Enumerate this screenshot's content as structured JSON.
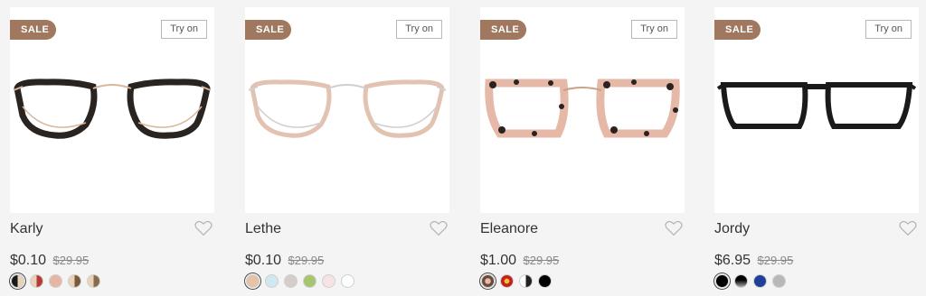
{
  "products": [
    {
      "sale_label": "SALE",
      "tryon_label": "Try on",
      "name": "Karly",
      "price": "$0.10",
      "old_price": "$29.95",
      "frame_color": "#2a2420",
      "rim_color": "#d9b79c",
      "style": "cateye",
      "swatches": [
        "#1a1a1a",
        "#b53a3a",
        "#e5b7a3",
        "#7a5a3a",
        "#b08a66"
      ]
    },
    {
      "sale_label": "SALE",
      "tryon_label": "Try on",
      "name": "Lethe",
      "price": "$0.10",
      "old_price": "$29.95",
      "frame_color": "#e2c3b2",
      "rim_color": "#cfcfcf",
      "style": "cateye",
      "swatches": [
        "#e6c3a7",
        "#cfe8f2",
        "#d7cccc",
        "#a5c66f",
        "#f7e3e3",
        "#ffffff"
      ]
    },
    {
      "sale_label": "SALE",
      "tryon_label": "Try on",
      "name": "Eleanore",
      "price": "$1.00",
      "old_price": "$29.95",
      "frame_color": "#e6b8a8",
      "rim_color": "#2b2320",
      "style": "square",
      "swatches": [
        "#6b4a3a",
        "#c21f1f",
        "#222222",
        "#000000"
      ]
    },
    {
      "sale_label": "SALE",
      "tryon_label": "Try on",
      "name": "Jordy",
      "price": "$6.95",
      "old_price": "$29.95",
      "frame_color": "#1a1a1a",
      "rim_color": "#1a1a1a",
      "style": "rect",
      "swatches": [
        "#000000",
        "#555555",
        "#1f3f9a",
        "#b8b8b8"
      ]
    }
  ],
  "icons": {
    "heart": "heart-icon"
  }
}
